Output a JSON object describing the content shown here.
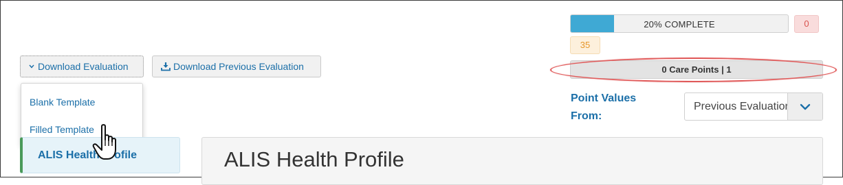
{
  "progress": {
    "label": "20% COMPLETE",
    "fraction": 0.2,
    "fill_color": "#3fa9d4"
  },
  "badges": {
    "red_count": "0",
    "orange_count": "35"
  },
  "care_points": {
    "text": "0 Care Points | 1"
  },
  "point_values": {
    "label_line1": "Point Values",
    "label_line2": "From:",
    "selected": "Previous Evaluation"
  },
  "toolbar": {
    "download_label": "Download Evaluation",
    "download_icon": "chevron-down-icon",
    "previous_label": "Download Previous Evaluation",
    "previous_icon": "download-icon"
  },
  "dropdown": {
    "items": [
      {
        "label": "Blank Template"
      },
      {
        "label": "Filled Template"
      }
    ]
  },
  "sidebar": {
    "active_tab": "ALIS Health Profile"
  },
  "main": {
    "title": "ALIS Health Profile"
  },
  "colors": {
    "link": "#1b6fa8",
    "annotation": "#e05a5a"
  }
}
